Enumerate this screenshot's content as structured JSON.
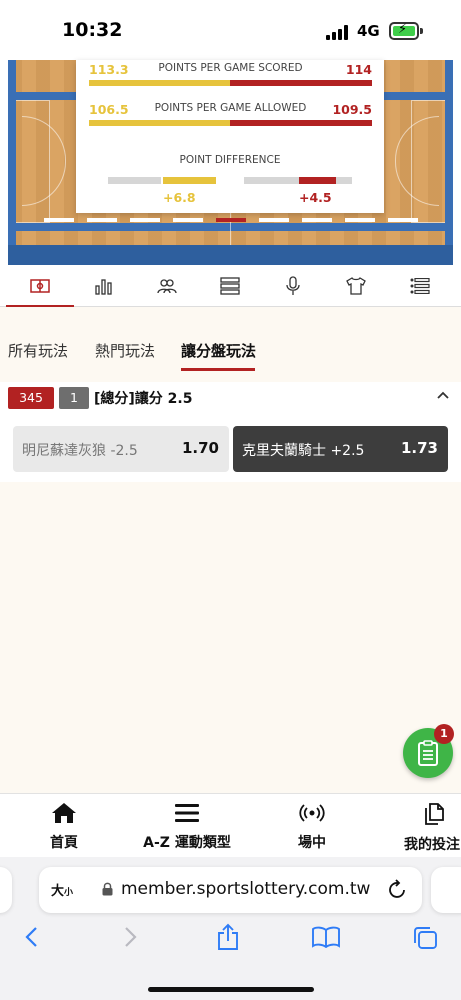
{
  "status_bar": {
    "time": "10:32",
    "network": "4G"
  },
  "game_stats": {
    "rows": [
      {
        "label": "POINTS PER GAME SCORED",
        "left_value": "113.3",
        "right_value": "114"
      },
      {
        "label": "POINTS PER GAME ALLOWED",
        "left_value": "106.5",
        "right_value": "109.5"
      }
    ],
    "point_difference": {
      "label": "POINT DIFFERENCE",
      "left_value": "+6.8",
      "right_value": "+4.5"
    },
    "colors": {
      "home": "#e6c33c",
      "away": "#b22222"
    }
  },
  "icon_tabs": [
    {
      "icon": "basketball-court-icon",
      "active": true
    },
    {
      "icon": "bar-chart-icon",
      "active": false
    },
    {
      "icon": "users-icon",
      "active": false
    },
    {
      "icon": "list-rows-icon",
      "active": false
    },
    {
      "icon": "microphone-icon",
      "active": false
    },
    {
      "icon": "jersey-icon",
      "active": false
    },
    {
      "icon": "bullet-list-icon",
      "active": false
    }
  ],
  "filter_tabs": [
    {
      "label": "所有玩法",
      "active": false
    },
    {
      "label": "熱門玩法",
      "active": false
    },
    {
      "label": "讓分盤玩法",
      "active": true
    }
  ],
  "market": {
    "badge_primary": "345",
    "badge_secondary": "1",
    "title": "[總分]讓分 2.5",
    "options": [
      {
        "team": "明尼蘇達灰狼 -2.5",
        "price": "1.70",
        "selected": false
      },
      {
        "team": "克里夫蘭騎士 +2.5",
        "price": "1.73",
        "selected": true
      }
    ]
  },
  "fab": {
    "icon": "bet-slip-icon",
    "badge_count": "1"
  },
  "bottom_nav": [
    {
      "label": "首頁",
      "icon": "home-icon"
    },
    {
      "label": "A-Z 運動類型",
      "icon": "menu-icon"
    },
    {
      "label": "場中",
      "icon": "live-broadcast-icon"
    },
    {
      "label": "我的投注",
      "icon": "documents-icon"
    }
  ],
  "browser": {
    "text_size_label": "大",
    "text_size_small": "小",
    "url": "member.sportslottery.com.tw",
    "toolbar_icons": [
      "back-icon",
      "forward-icon",
      "share-icon",
      "bookmarks-icon",
      "tabs-icon"
    ]
  }
}
